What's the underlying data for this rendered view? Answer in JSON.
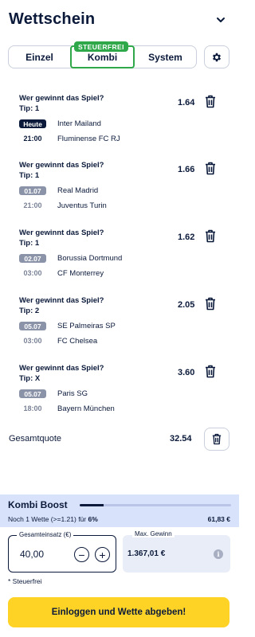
{
  "header": {
    "title": "Wettschein"
  },
  "tabs": [
    {
      "label": "Einzel",
      "active": false
    },
    {
      "label": "Kombi",
      "active": true
    },
    {
      "label": "System",
      "active": false
    }
  ],
  "tab_badge": "STEUERFREI",
  "bets": [
    {
      "question": "Wer gewinnt das Spiel?",
      "tip": "Tip: 1",
      "odd": "1.64",
      "date": "Heute",
      "time": "21:00",
      "home": "Inter Mailand",
      "away": "Fluminense FC RJ"
    },
    {
      "question": "Wer gewinnt das Spiel?",
      "tip": "Tip: 1",
      "odd": "1.66",
      "date": "01.07",
      "time": "21:00",
      "home": "Real Madrid",
      "away": "Juventus Turin"
    },
    {
      "question": "Wer gewinnt das Spiel?",
      "tip": "Tip: 1",
      "odd": "1.62",
      "date": "02.07",
      "time": "03:00",
      "home": "Borussia Dortmund",
      "away": "CF Monterrey"
    },
    {
      "question": "Wer gewinnt das Spiel?",
      "tip": "Tip: 2",
      "odd": "2.05",
      "date": "05.07",
      "time": "03:00",
      "home": "SE Palmeiras SP",
      "away": "FC Chelsea"
    },
    {
      "question": "Wer gewinnt das Spiel?",
      "tip": "Tip: X",
      "odd": "3.60",
      "date": "05.07",
      "time": "18:00",
      "home": "Paris SG",
      "away": "Bayern München"
    }
  ],
  "total": {
    "label": "Gesamtquote",
    "value": "32.54"
  },
  "boost": {
    "title": "Kombi Boost",
    "note_prefix": "Noch 1 Wette (>=1.21) für",
    "note_percent": "6%",
    "amount": "61,83 €",
    "progress": 0.16
  },
  "stake": {
    "label": "Gesamteinsatz (€)",
    "value": "40,00",
    "minus": "−",
    "plus": "+"
  },
  "max_win": {
    "label": "Max. Gewinn",
    "value": "1.367,01 €",
    "info": "i"
  },
  "tax_note": "* Steuerfrei",
  "cta": {
    "label": "Einloggen und Wette abgeben!"
  },
  "colors": {
    "navy": "#0b1a3a",
    "green": "#2fa84a",
    "yellow": "#ffd326",
    "boost_bg": "#d9e2fb"
  }
}
